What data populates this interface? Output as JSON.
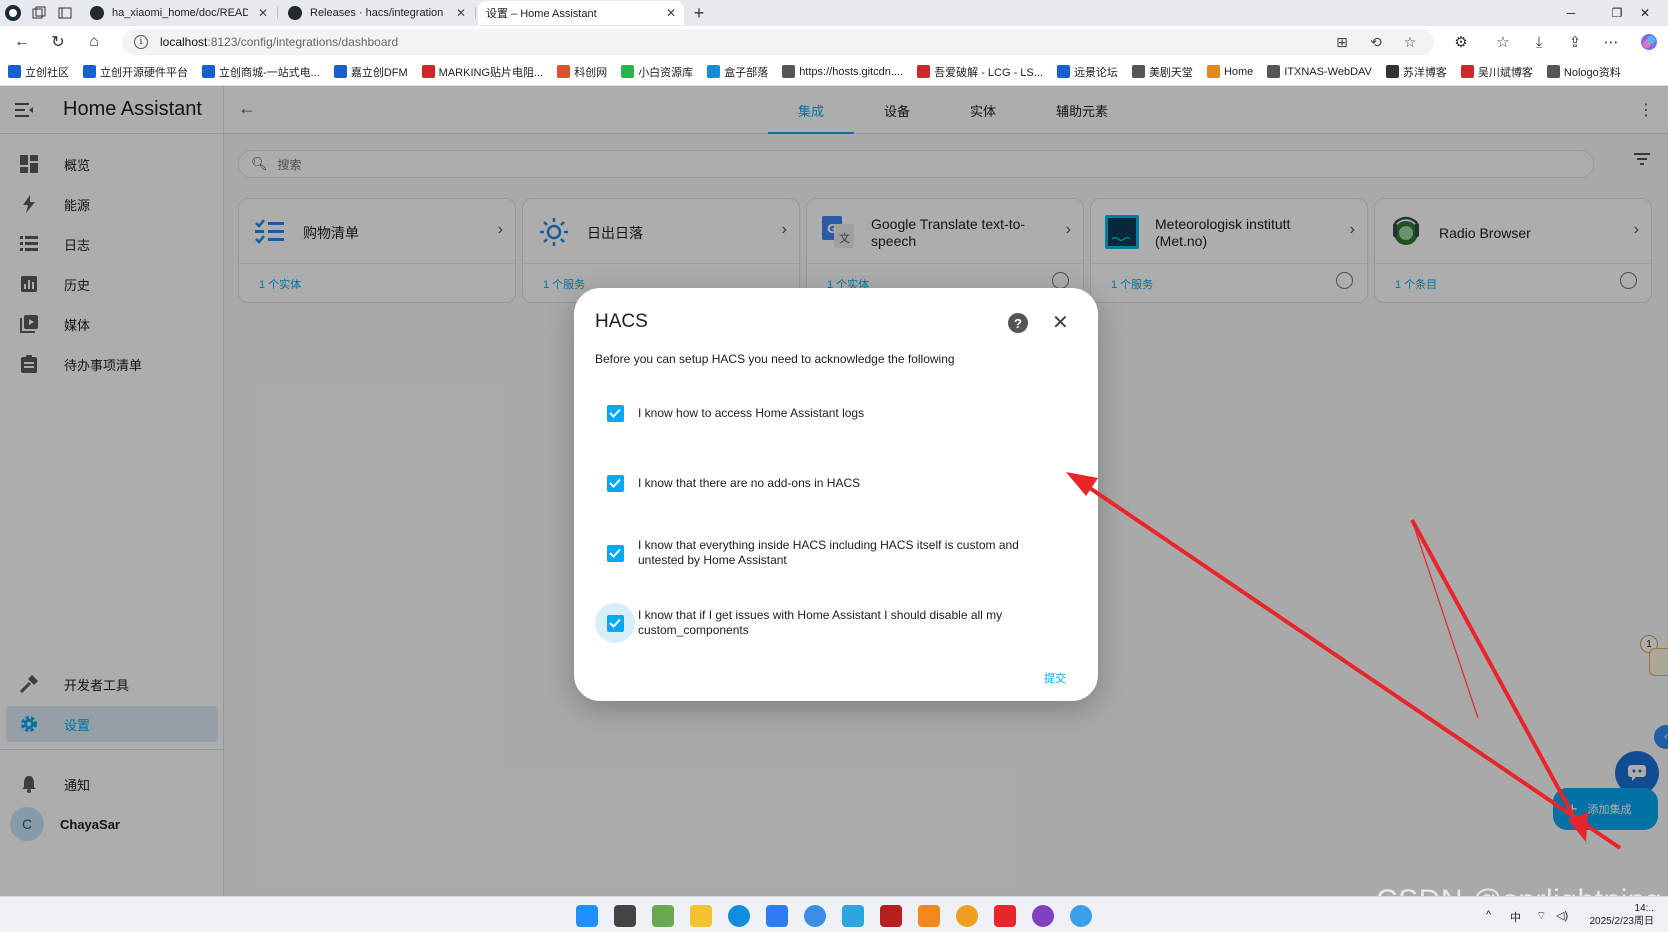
{
  "browser": {
    "tabs": [
      {
        "title": "ha_xiaomi_home/doc/README_zh"
      },
      {
        "title": "Releases · hacs/integration"
      },
      {
        "title": "设置 – Home Assistant"
      }
    ],
    "url_host": "localhost",
    "url_rest": ":8123/config/integrations/dashboard",
    "bookmarks": [
      {
        "label": "立创社区",
        "color": "#1a5fd0"
      },
      {
        "label": "立创开源硬件平台",
        "color": "#1a5fd0"
      },
      {
        "label": "立创商城-一站式电...",
        "color": "#1a5fd0"
      },
      {
        "label": "嘉立创DFM",
        "color": "#1a5fd0"
      },
      {
        "label": "MARKING贴片电阻...",
        "color": "#d0262a"
      },
      {
        "label": "科创网",
        "color": "#e0502a"
      },
      {
        "label": "小白资源库",
        "color": "#2bb24c"
      },
      {
        "label": "盒子部落",
        "color": "#1a8ad0"
      },
      {
        "label": "https://hosts.gitcdn....",
        "color": "#555555"
      },
      {
        "label": "吾爱破解 - LCG - LS...",
        "color": "#d0262a"
      },
      {
        "label": "远景论坛",
        "color": "#1a5fd0"
      },
      {
        "label": "美剧天堂",
        "color": "#555555"
      },
      {
        "label": "Home",
        "color": "#e08a1a"
      },
      {
        "label": "ITXNAS-WebDAV",
        "color": "#555555"
      },
      {
        "label": "苏洋博客",
        "color": "#333333"
      },
      {
        "label": "吴川斌博客",
        "color": "#d0262a"
      },
      {
        "label": "Nologo资料",
        "color": "#555555"
      }
    ]
  },
  "sidebar": {
    "title": "Home Assistant",
    "items": [
      {
        "label": "概览",
        "icon": "dashboard-icon"
      },
      {
        "label": "能源",
        "icon": "lightning-icon"
      },
      {
        "label": "日志",
        "icon": "list-icon"
      },
      {
        "label": "历史",
        "icon": "chart-icon"
      },
      {
        "label": "媒体",
        "icon": "media-icon"
      },
      {
        "label": "待办事项清单",
        "icon": "clipboard-icon"
      }
    ],
    "developer_tools": "开发者工具",
    "settings": "设置",
    "notifications": "通知",
    "user": {
      "initial": "C",
      "name": "ChayaSar"
    }
  },
  "topbar": {
    "tabs": [
      "集成",
      "设备",
      "实体",
      "辅助元素"
    ],
    "active_tab": 0
  },
  "search": {
    "placeholder": "搜索"
  },
  "integrations": [
    {
      "title": "购物清单",
      "link": "1 个实体",
      "icon": "shopping-list-icon"
    },
    {
      "title": "日出日落",
      "link": "1 个服务",
      "icon": "sun-icon"
    },
    {
      "title": "Google Translate text-to-speech",
      "link": "1 个实体",
      "icon": "google-translate-icon"
    },
    {
      "title": "Meteorologisk institutt (Met.no)",
      "link": "1 个服务",
      "icon": "met-no-icon"
    },
    {
      "title": "Radio Browser",
      "link": "1 个条目",
      "icon": "radio-icon"
    }
  ],
  "fab": {
    "label": "添加集成"
  },
  "dialog": {
    "title": "HACS",
    "description": "Before you can setup HACS you need to acknowledge the following",
    "checks": [
      {
        "label": "I know how to access Home Assistant logs",
        "checked": true
      },
      {
        "label": "I know that there are no add-ons in HACS",
        "checked": true
      },
      {
        "label": "I know that everything inside HACS including HACS itself is custom and untested by Home Assistant",
        "checked": true
      },
      {
        "label": "I know that if I get issues with Home Assistant I should disable all my custom_components",
        "checked": true
      }
    ],
    "submit": "提交"
  },
  "side_badge": "1",
  "watermark": "CSDN @sprlightning",
  "taskbar": {
    "ime": "中",
    "time": "14:..",
    "date": "2025/2/23周日"
  },
  "colors": {
    "accent": "#03a9f4",
    "arrow": "#e8262a",
    "sidebar_active_bg": "#dceaf7"
  }
}
